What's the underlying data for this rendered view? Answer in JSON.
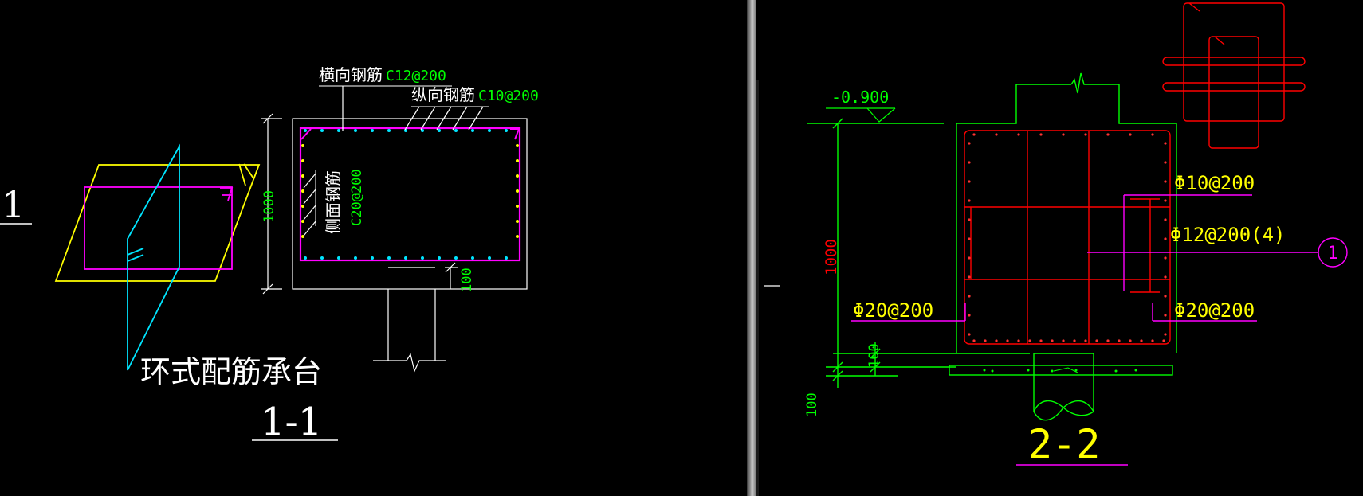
{
  "colors": {
    "background": "#000000",
    "white": "#ffffff",
    "green": "#00ff00",
    "yellow": "#ffff00",
    "magenta": "#ff00ff",
    "cyan": "#00ffff",
    "red": "#ff0000",
    "divider": "#9a9a9a"
  },
  "left_view": {
    "partial_label": "1",
    "transverse_label": "横向钢筋",
    "transverse_spec": "C12@200",
    "longitudinal_label": "纵向钢筋",
    "longitudinal_spec": "C10@200",
    "side_label": "侧面钢筋",
    "side_spec": "C20@200",
    "height_dim": "1000",
    "cover_dim": "100",
    "caption": "环式配筋承台",
    "section_title": "1-1"
  },
  "right_view": {
    "elevation": "-0.900",
    "height_dim": "1000",
    "dim_100_a": "100",
    "dim_100_b": "100",
    "bar_phi10": "Φ10@200",
    "bar_phi12": "Φ12@200(4)",
    "bar_phi20_left": "Φ20@200",
    "bar_phi20_right": "Φ20@200",
    "detail_marker": "1",
    "section_title": "2-2"
  }
}
